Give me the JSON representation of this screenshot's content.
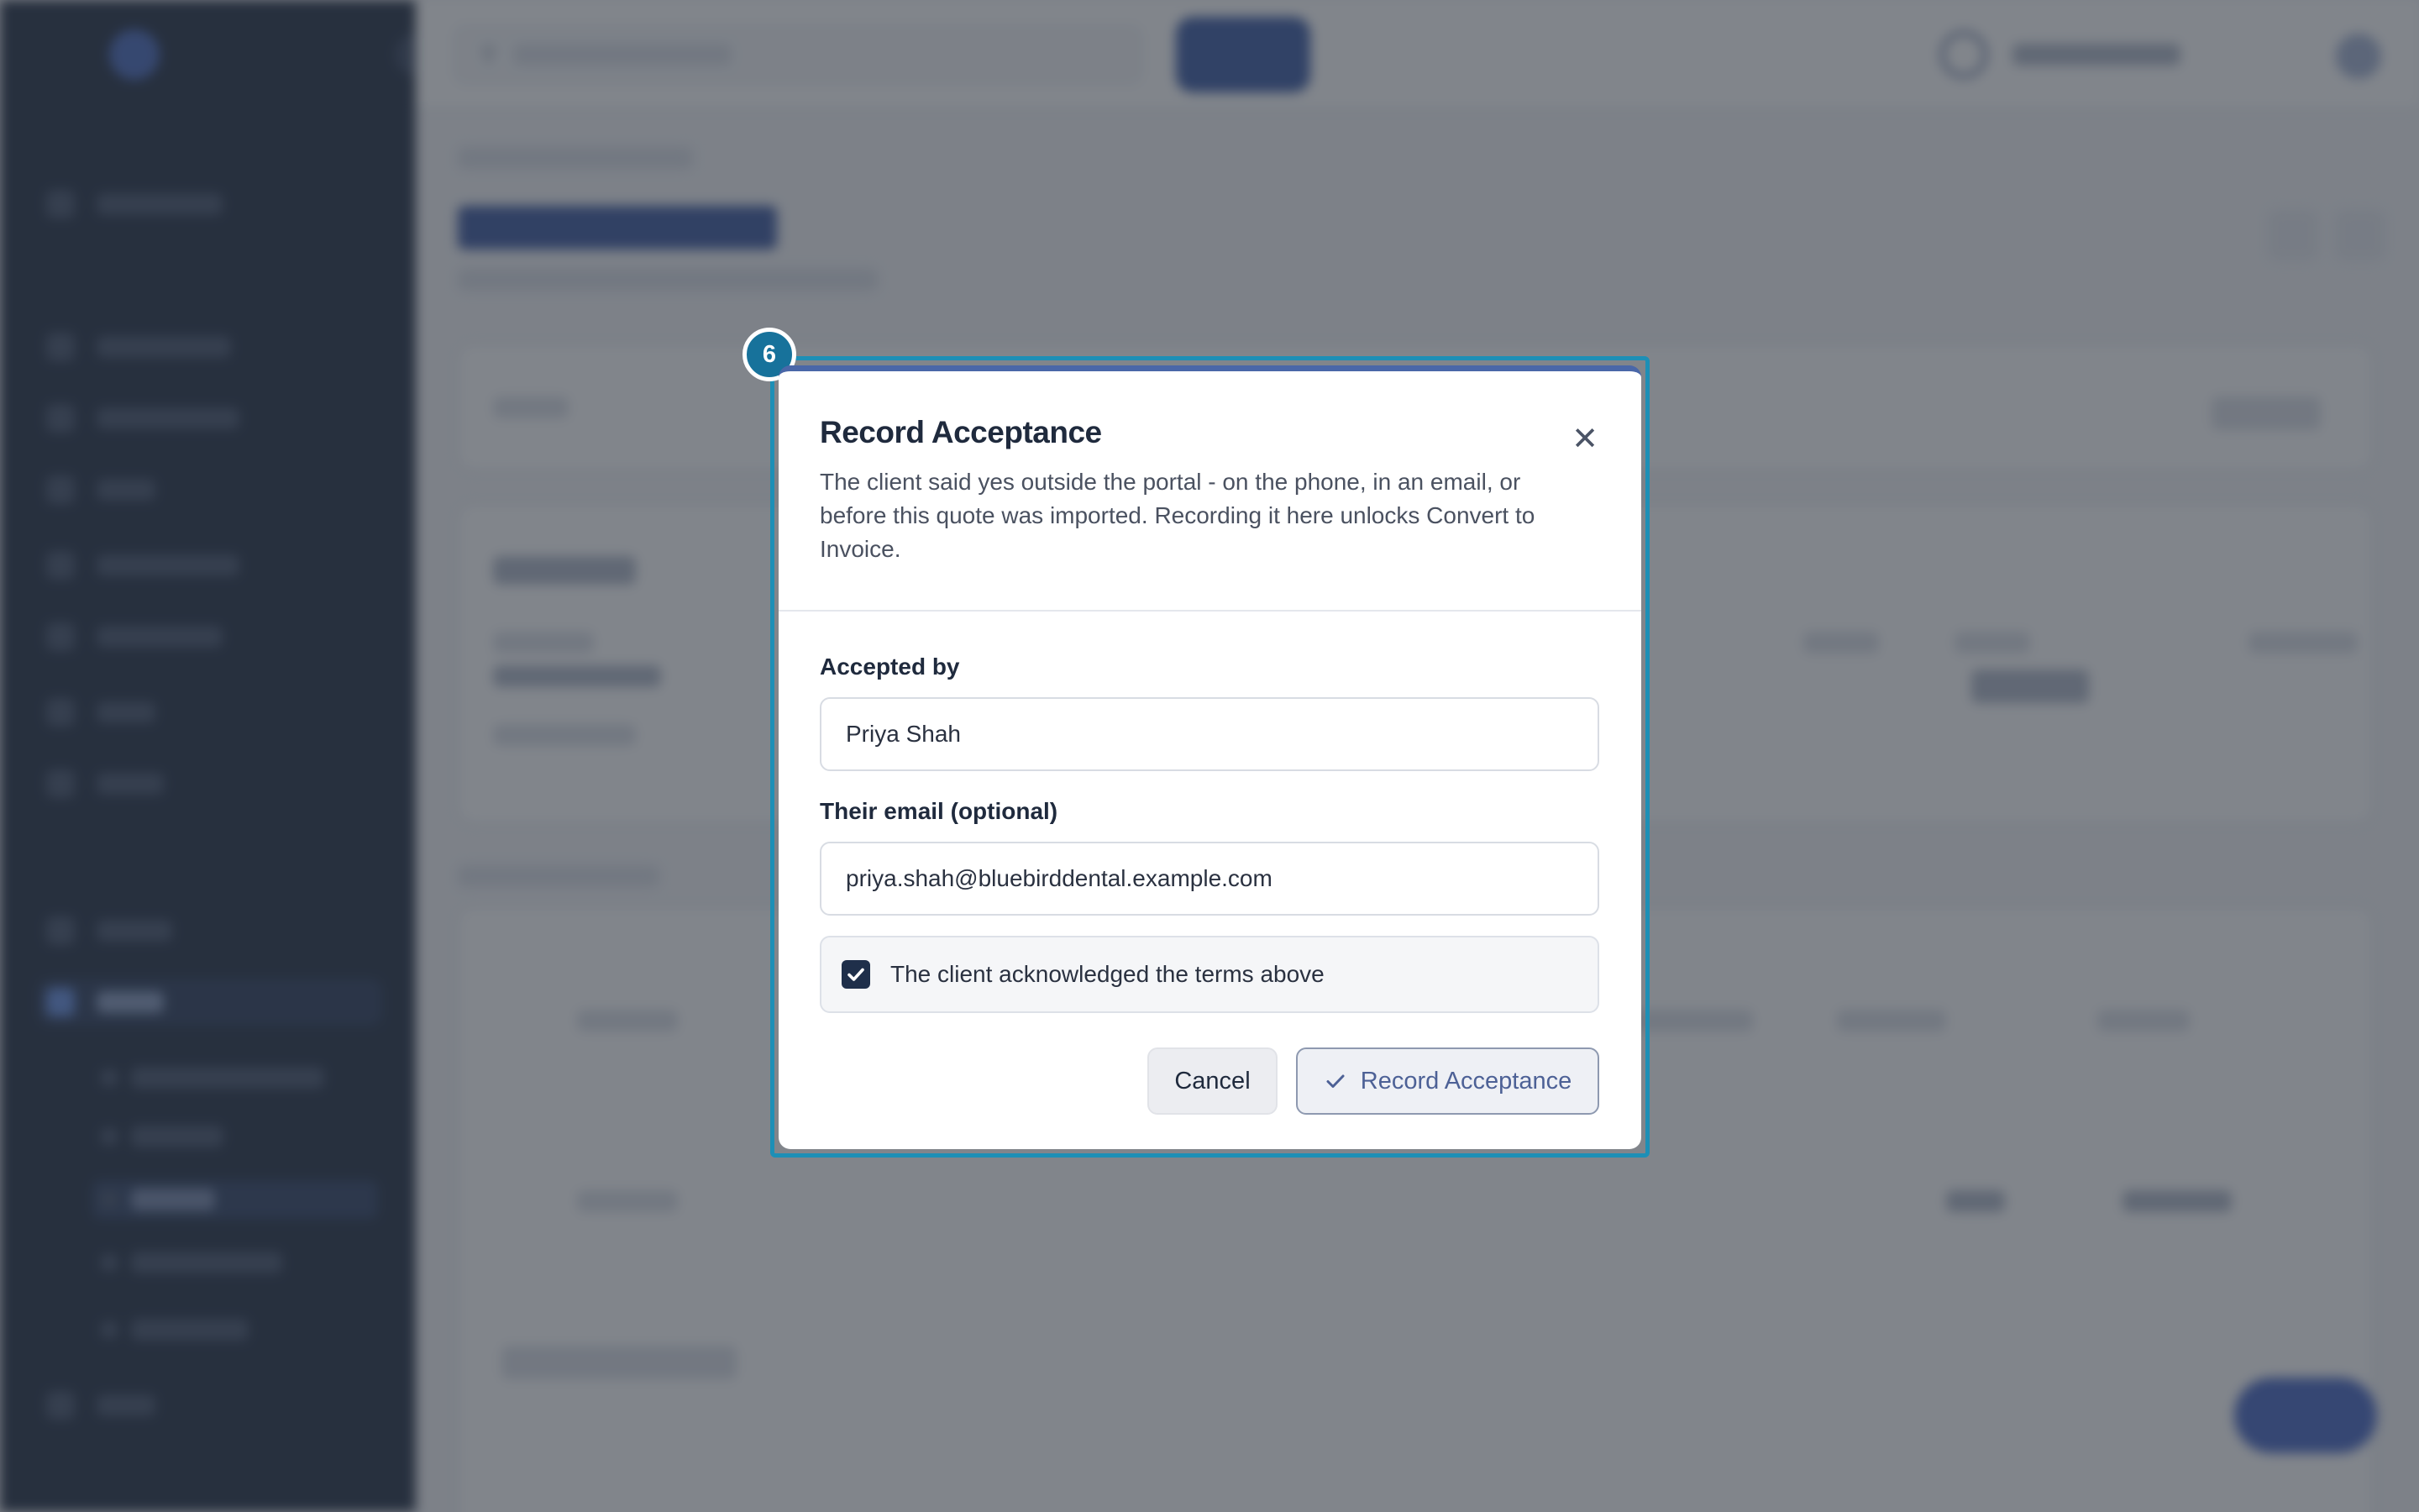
{
  "dialog": {
    "step_number": "6",
    "title": "Record Acceptance",
    "description": "The client said yes outside the portal - on the phone, in an email, or before this quote was imported. Recording it here unlocks Convert to Invoice.",
    "close_icon": "close-icon",
    "accepted_by_label": "Accepted by",
    "accepted_by_value": "Priya Shah",
    "email_label": "Their email (optional)",
    "email_value": "priya.shah@bluebirddental.example.com",
    "ack_label": "The client acknowledged the terms above",
    "ack_checked": true,
    "cancel_label": "Cancel",
    "record_label": "Record Acceptance",
    "record_icon": "check-icon"
  },
  "colors": {
    "highlight": "#1d8fb6",
    "step_badge": "#17729b",
    "dialog_accent": "#4a67a8",
    "checkbox": "#1f2f4a",
    "overlay": "rgba(52,58,68,0.62)"
  }
}
